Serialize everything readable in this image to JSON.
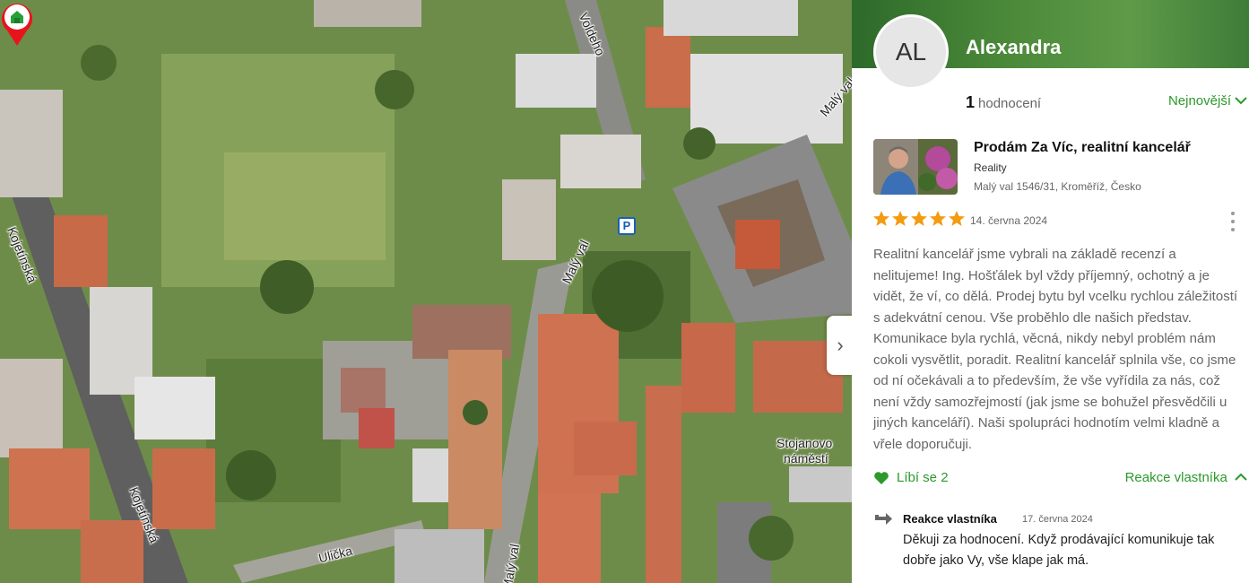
{
  "map": {
    "street_labels": [
      "Kojetínská",
      "Kojetínská",
      "Voldeho",
      "Malý val",
      "Malý val",
      "Malý val",
      "Ulička",
      "Stojanovo",
      "náměstí"
    ],
    "parking_icon": "P",
    "collapse_icon": "›"
  },
  "profile": {
    "initials": "AL",
    "name": "Alexandra",
    "review_count": "1",
    "review_count_label": "hodnocení",
    "sort_label": "Nejnovější",
    "sort_icon": "chevron-down-icon"
  },
  "review": {
    "business_name": "Prodám Za Víc, realitní kancelář",
    "business_category": "Reality",
    "business_address": "Malý val 1546/31, Kroměříž, Česko",
    "rating": 5,
    "date": "14. června 2024",
    "text": "Realitní kancelář jsme vybrali na základě recenzí a nelitujeme! Ing. Hošťálek byl vždy příjemný, ochotný a je vidět, že ví, co dělá. Prodej bytu byl vcelku rychlou záležitostí s adekvátní cenou. Vše proběhlo dle našich představ. Komunikace byla rychlá, věcná, nikdy nebyl problém nám cokoli vysvětlit, poradit. Realitní kancelář splnila vše, co jsme od ní očekávali a to především, že vše vyřídila za nás, což není vždy samozřejmostí (jak jsme se bohužel přesvědčili u jiných kanceláří). Naši spolupráci hodnotím velmi kladně a vřele doporučuji.",
    "like_label": "Líbí se 2",
    "owner_toggle_label": "Reakce vlastníka",
    "owner_toggle_icon": "chevron-up-icon"
  },
  "owner_reply": {
    "author": "Reakce vlastníka",
    "date": "17. června 2024",
    "text": "Děkuji za hodnocení. Když prodávající komunikuje tak dobře jako Vy, vše klape jak má."
  },
  "colors": {
    "accent_green": "#2b9a2a",
    "star_orange": "#f39c12",
    "marker_red": "#e8141c"
  }
}
